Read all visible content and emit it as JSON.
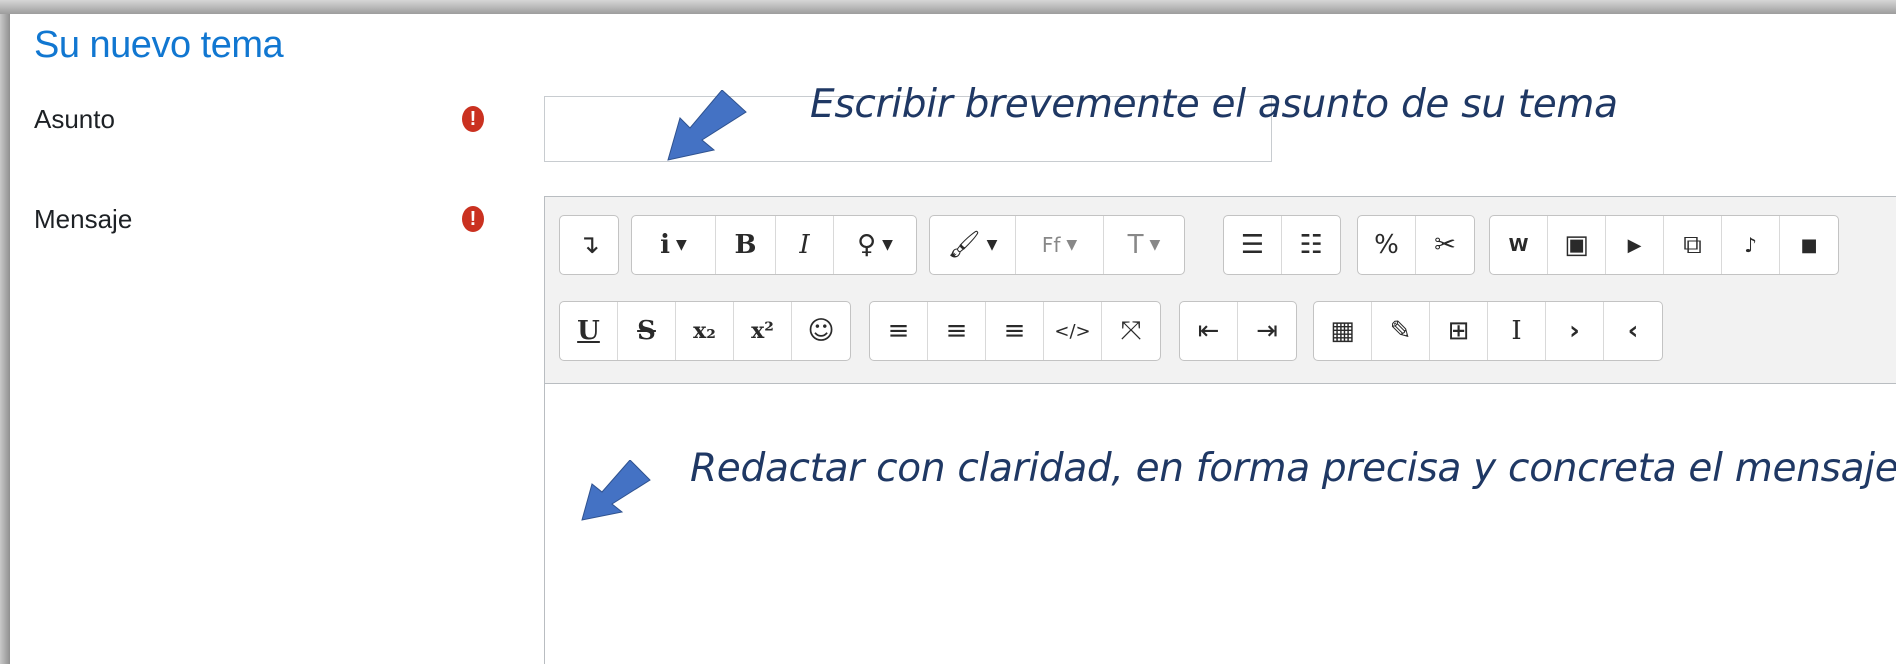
{
  "form": {
    "title": "Su nuevo tema",
    "subject_label": "Asunto",
    "message_label": "Mensaje",
    "required_icon": "exclamation-circle-icon",
    "subject_value": "",
    "message_value": ""
  },
  "toolbar": {
    "row1": [
      {
        "name": "toolbar-toggle-icon",
        "glyph": "↴"
      },
      {
        "name": "info-icon",
        "glyph": "i"
      },
      {
        "name": "bold-icon",
        "glyph": "B"
      },
      {
        "name": "italic-icon",
        "glyph": "I"
      },
      {
        "name": "lightbulb-icon",
        "glyph": "💡"
      },
      {
        "name": "paintbrush-icon",
        "glyph": "🖌"
      },
      {
        "name": "font-family-icon",
        "glyph": "Ff"
      },
      {
        "name": "font-size-icon",
        "glyph": "T"
      },
      {
        "name": "unordered-list-icon",
        "glyph": "☰"
      },
      {
        "name": "ordered-list-icon",
        "glyph": "☷"
      },
      {
        "name": "link-icon",
        "glyph": "%"
      },
      {
        "name": "unlink-icon",
        "glyph": "✂"
      },
      {
        "name": "word-paste-icon",
        "glyph": "W"
      },
      {
        "name": "image-icon",
        "glyph": "▣"
      },
      {
        "name": "media-icon",
        "glyph": "▶"
      },
      {
        "name": "manage-files-icon",
        "glyph": "⧉"
      },
      {
        "name": "audio-icon",
        "glyph": "♪"
      },
      {
        "name": "video-icon",
        "glyph": "■"
      }
    ],
    "row2": [
      {
        "name": "underline-icon",
        "glyph": "U"
      },
      {
        "name": "strikethrough-icon",
        "glyph": "S"
      },
      {
        "name": "subscript-icon",
        "glyph": "x₂"
      },
      {
        "name": "superscript-icon",
        "glyph": "x²"
      },
      {
        "name": "emoticon-icon",
        "glyph": "☺"
      },
      {
        "name": "align-left-icon",
        "glyph": "≡"
      },
      {
        "name": "align-center-icon",
        "glyph": "≡"
      },
      {
        "name": "align-right-icon",
        "glyph": "≡"
      },
      {
        "name": "html-icon",
        "glyph": "</>"
      },
      {
        "name": "fullscreen-icon",
        "glyph": "⤧"
      },
      {
        "name": "outdent-icon",
        "glyph": "⇤"
      },
      {
        "name": "indent-icon",
        "glyph": "⇥"
      },
      {
        "name": "calculator-icon",
        "glyph": "▦"
      },
      {
        "name": "edit-icon",
        "glyph": "✎"
      },
      {
        "name": "table-icon",
        "glyph": "⊞"
      },
      {
        "name": "text-cursor-icon",
        "glyph": "I"
      },
      {
        "name": "chevron-right-icon",
        "glyph": "›"
      },
      {
        "name": "chevron-left-icon",
        "glyph": "‹"
      }
    ]
  },
  "annotations": {
    "subject_note": "Escribir brevemente el asunto de su tema",
    "message_note": "Redactar con claridad, en forma precisa y concreta el mensaje",
    "arrow_color": "#4472c4"
  }
}
